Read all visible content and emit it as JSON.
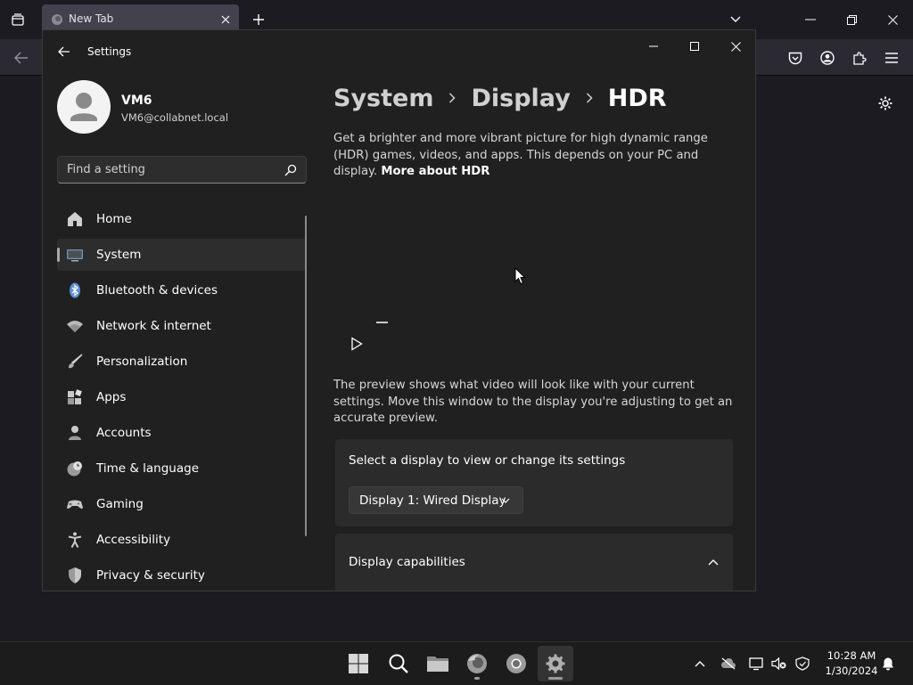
{
  "browser": {
    "tab_title": "New Tab"
  },
  "settings_window": {
    "title": "Settings",
    "profile": {
      "name": "VM6",
      "email": "VM6@collabnet.local"
    },
    "search": {
      "placeholder": "Find a setting"
    },
    "nav": [
      {
        "label": "Home",
        "icon": "home-icon",
        "active": false
      },
      {
        "label": "System",
        "icon": "system-icon",
        "active": true
      },
      {
        "label": "Bluetooth & devices",
        "icon": "bluetooth-icon",
        "active": false
      },
      {
        "label": "Network & internet",
        "icon": "wifi-icon",
        "active": false
      },
      {
        "label": "Personalization",
        "icon": "brush-icon",
        "active": false
      },
      {
        "label": "Apps",
        "icon": "apps-icon",
        "active": false
      },
      {
        "label": "Accounts",
        "icon": "account-icon",
        "active": false
      },
      {
        "label": "Time & language",
        "icon": "globe-clock-icon",
        "active": false
      },
      {
        "label": "Gaming",
        "icon": "gamepad-icon",
        "active": false
      },
      {
        "label": "Accessibility",
        "icon": "accessibility-icon",
        "active": false
      },
      {
        "label": "Privacy & security",
        "icon": "shield-icon",
        "active": false
      }
    ],
    "breadcrumb": [
      "System",
      "Display",
      "HDR"
    ],
    "description": "Get a brighter and more vibrant picture for high dynamic range (HDR) games, videos, and apps. This depends on your PC and display.",
    "more_link": "More about HDR",
    "preview_description": "The preview shows what video will look like with your current settings. Move this window to the display you're adjusting to get an accurate preview.",
    "select_display_label": "Select a display to view or change its settings",
    "display_dropdown_value": "Display 1: Wired Display",
    "capabilities_label": "Display capabilities"
  },
  "taskbar": {
    "time": "10:28 AM",
    "date": "1/30/2024"
  },
  "colors": {
    "window_bg": "#202020",
    "card_bg": "#2b2b2b",
    "taskbar_bg": "#1c1c1c",
    "browser_bg": "#1c1b22"
  }
}
